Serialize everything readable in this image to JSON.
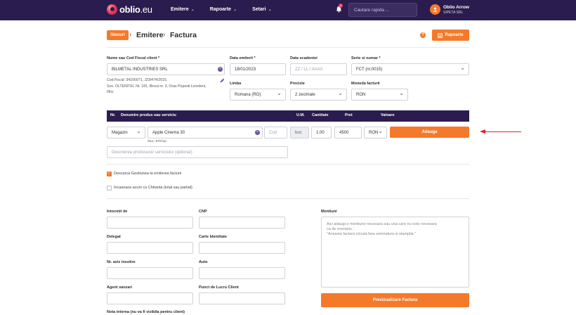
{
  "nav": {
    "logo_main": "oblio",
    "logo_suffix": ".eu",
    "menu": [
      {
        "label": "Emitere"
      },
      {
        "label": "Rapoarte"
      },
      {
        "label": "Setari"
      }
    ],
    "notification_count": "1",
    "search_placeholder": "Cautare rapida ...",
    "user_name": "Oblio Arrow",
    "user_company": "SIPETA SRL"
  },
  "breadcrumb": {
    "badge": "Stocuri",
    "items": [
      "Emitere",
      "Factura"
    ],
    "separator": "›"
  },
  "header": {
    "reports_button": "Rapoarte"
  },
  "client": {
    "label": "Nume sau Cod Fiscal client *",
    "value": "BILMETAL INDUSTRIES SRL",
    "info_lines": [
      "Cod Fiscal: 34100071, J23/474/2015,",
      "Sos. OLTENITEI, Nr. 181, Biroul nr. 3, Oras Popesti Leordeni,",
      "Ilfov"
    ]
  },
  "invoice": {
    "issue_date_label": "Data emiterii *",
    "issue_date": "18/01/2023",
    "due_date_label": "Data scadentei",
    "due_date_placeholder": "ZZ / LL / AAAA",
    "series_label": "Serie si numar *",
    "series_value": "FCT (nr.0015)",
    "language_label": "Limba",
    "language_value": "Romana (RO)",
    "precision_label": "Precizie",
    "precision_value": "2 zecimale",
    "currency_label": "Moneda facturii",
    "currency_value": "RON"
  },
  "table": {
    "headers": [
      "Nr.",
      "Denumire produs sau serviciu",
      "U.M.",
      "Cantitate",
      "Pret",
      "Valoare"
    ]
  },
  "product_row": {
    "warehouse": "Magazin",
    "product_name": "Apple Cinema 30",
    "code_placeholder": "Cod",
    "unit": "buc",
    "quantity": "1.00",
    "price": "4500",
    "currency": "RON",
    "add_button": "Adauga",
    "stock_note": "Stoc: 979 buc",
    "description_placeholder": "Descrierea produsului/ serviciului (optional)"
  },
  "options": {
    "discharge_label": "Descarca Gestiunea la emiterea facturii",
    "discharge_checked": true,
    "cash_label": "Incaseaza acum cu Chitanta (total sau partial)",
    "cash_checked": false
  },
  "details": {
    "prepared_by_label": "Intocmit de",
    "cnp_label": "CNP",
    "delegate_label": "Delegat",
    "id_card_label": "Carte Identitate",
    "notice_label": "Nr. aviz insotire",
    "car_label": "Auto",
    "agent_label": "Agent vanzari",
    "work_point_label": "Punct de Lucru Client",
    "internal_note_label": "Nota interna (nu va fi vizibila pentru client)"
  },
  "mentions": {
    "label": "Mentiuni",
    "placeholder_lines": [
      "Aici adaugi o mentiune necesara sau una care nu este necesara",
      "ca de exemplu :",
      "\"Aceasta factura circula fara semnatura si stampila.\""
    ],
    "preview_button": "Previzualizare Factura"
  },
  "colors": {
    "navbar": "#2b1c4f",
    "accent": "#f5792a",
    "annotation_arrow": "#dd2222"
  }
}
